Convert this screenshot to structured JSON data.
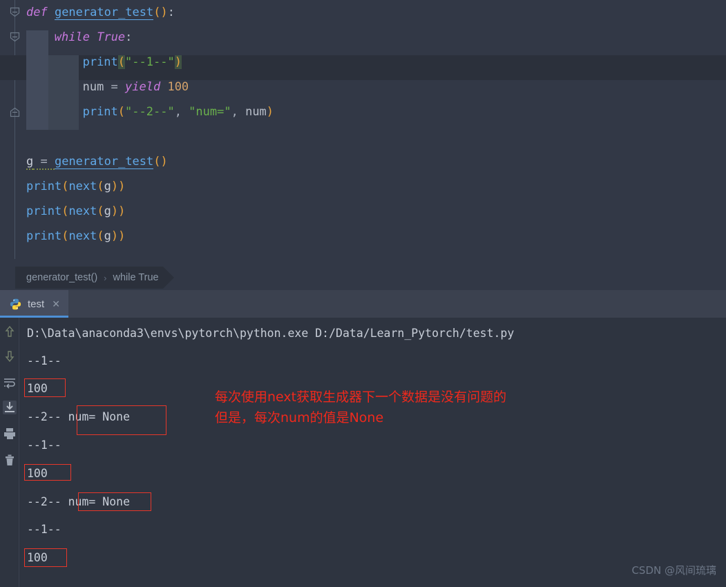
{
  "editor": {
    "lines": [
      {
        "indent": 0,
        "tokens": [
          {
            "t": "def ",
            "c": "kw"
          },
          {
            "t": "generator_test",
            "c": "fname-u"
          },
          {
            "t": "(",
            "c": "paren"
          },
          {
            "t": ")",
            "c": "paren"
          },
          {
            "t": ":",
            "c": "colon"
          }
        ]
      },
      {
        "indent": 1,
        "tokens": [
          {
            "t": "while ",
            "c": "kw"
          },
          {
            "t": "True",
            "c": "kw"
          },
          {
            "t": ":",
            "c": "colon"
          }
        ]
      },
      {
        "indent": 2,
        "tokens": [
          {
            "t": "print",
            "c": "builtin"
          },
          {
            "t": "(",
            "c": "bracket-hl"
          },
          {
            "t": "\"--1--\"",
            "c": "str"
          },
          {
            "t": ")",
            "c": "bracket-hl"
          }
        ]
      },
      {
        "indent": 2,
        "tokens": [
          {
            "t": "num ",
            "c": "ident"
          },
          {
            "t": "= ",
            "c": "op"
          },
          {
            "t": "yield ",
            "c": "kw"
          },
          {
            "t": "100",
            "c": "num"
          }
        ]
      },
      {
        "indent": 2,
        "tokens": [
          {
            "t": "print",
            "c": "builtin"
          },
          {
            "t": "(",
            "c": "paren"
          },
          {
            "t": "\"--2--\"",
            "c": "str"
          },
          {
            "t": ", ",
            "c": "op"
          },
          {
            "t": "\"num=\"",
            "c": "str"
          },
          {
            "t": ", ",
            "c": "op"
          },
          {
            "t": "num",
            "c": "ident"
          },
          {
            "t": ")",
            "c": "paren"
          }
        ]
      },
      {
        "indent": 0,
        "tokens": []
      },
      {
        "indent": 0,
        "tokens": [
          {
            "t": "g",
            "c": "var-g squiggle"
          },
          {
            "t": " = ",
            "c": "op squiggle"
          },
          {
            "t": "generator_test",
            "c": "fname-u"
          },
          {
            "t": "(",
            "c": "paren"
          },
          {
            "t": ")",
            "c": "paren"
          }
        ]
      },
      {
        "indent": 0,
        "tokens": [
          {
            "t": "print",
            "c": "builtin"
          },
          {
            "t": "(",
            "c": "paren"
          },
          {
            "t": "next",
            "c": "builtin"
          },
          {
            "t": "(",
            "c": "paren"
          },
          {
            "t": "g",
            "c": "var-g"
          },
          {
            "t": ")",
            "c": "paren"
          },
          {
            "t": ")",
            "c": "paren"
          }
        ]
      },
      {
        "indent": 0,
        "tokens": [
          {
            "t": "print",
            "c": "builtin"
          },
          {
            "t": "(",
            "c": "paren"
          },
          {
            "t": "next",
            "c": "builtin"
          },
          {
            "t": "(",
            "c": "paren"
          },
          {
            "t": "g",
            "c": "var-g"
          },
          {
            "t": ")",
            "c": "paren"
          },
          {
            "t": ")",
            "c": "paren"
          }
        ]
      },
      {
        "indent": 0,
        "tokens": [
          {
            "t": "print",
            "c": "builtin"
          },
          {
            "t": "(",
            "c": "paren"
          },
          {
            "t": "next",
            "c": "builtin"
          },
          {
            "t": "(",
            "c": "paren"
          },
          {
            "t": "g",
            "c": "var-g"
          },
          {
            "t": ")",
            "c": "paren"
          },
          {
            "t": ")",
            "c": "paren"
          }
        ]
      }
    ],
    "highlighted_line_index": 2,
    "source_text": "def generator_test():\n    while True:\n        print(\"--1--\")\n        num = yield 100\n        print(\"--2--\", \"num=\", num)\n\ng = generator_test()\nprint(next(g))\nprint(next(g))\nprint(next(g))"
  },
  "breadcrumb": {
    "items": [
      "generator_test()",
      "while True"
    ],
    "separator": "›"
  },
  "tab": {
    "label": "test",
    "close_glyph": "✕",
    "icon": "python-icon"
  },
  "console_toolbar": {
    "icons": [
      {
        "name": "scroll-up-icon",
        "glyph": "↑"
      },
      {
        "name": "scroll-down-icon",
        "glyph": "↓"
      },
      {
        "name": "soft-wrap-icon",
        "glyph": "↩"
      },
      {
        "name": "scroll-to-end-icon",
        "glyph": "⤓"
      },
      {
        "name": "print-icon",
        "glyph": "⎙"
      },
      {
        "name": "clear-all-icon",
        "glyph": "Ὕ1"
      }
    ]
  },
  "console": {
    "command_line": "D:\\Data\\anaconda3\\envs\\pytorch\\python.exe D:/Data/Learn_Pytorch/test.py",
    "lines": [
      {
        "text": "--1--",
        "boxed": false
      },
      {
        "text": "100",
        "boxed": true
      },
      {
        "text": "--2-- num= None",
        "boxed": true,
        "box_from": 6
      },
      {
        "text": "--1--",
        "boxed": false
      },
      {
        "text": "100",
        "boxed": true
      },
      {
        "text": "--2-- num= None",
        "boxed": true,
        "box_from": 6
      },
      {
        "text": "--1--",
        "boxed": false
      },
      {
        "text": "100",
        "boxed": true
      }
    ]
  },
  "annotation": {
    "line1": "每次使用next获取生成器下一个数据是没有问题的",
    "line2": "但是，每次num的值是None",
    "color": "#f0291c"
  },
  "watermark": {
    "text": "CSDN @风间琉璃"
  },
  "colors": {
    "editor_bg": "#323846",
    "console_bg": "#2e3440",
    "tabbar_bg": "#3b414f",
    "tab_active_bg": "#464d5e",
    "tab_underline": "#4d90d6",
    "keyword": "#c778dd",
    "function": "#61a9e8",
    "string": "#6ab04c",
    "number": "#d4a26a",
    "paren": "#e8a33d",
    "annotation_red": "#f0291c",
    "box_red": "#e8372a"
  }
}
